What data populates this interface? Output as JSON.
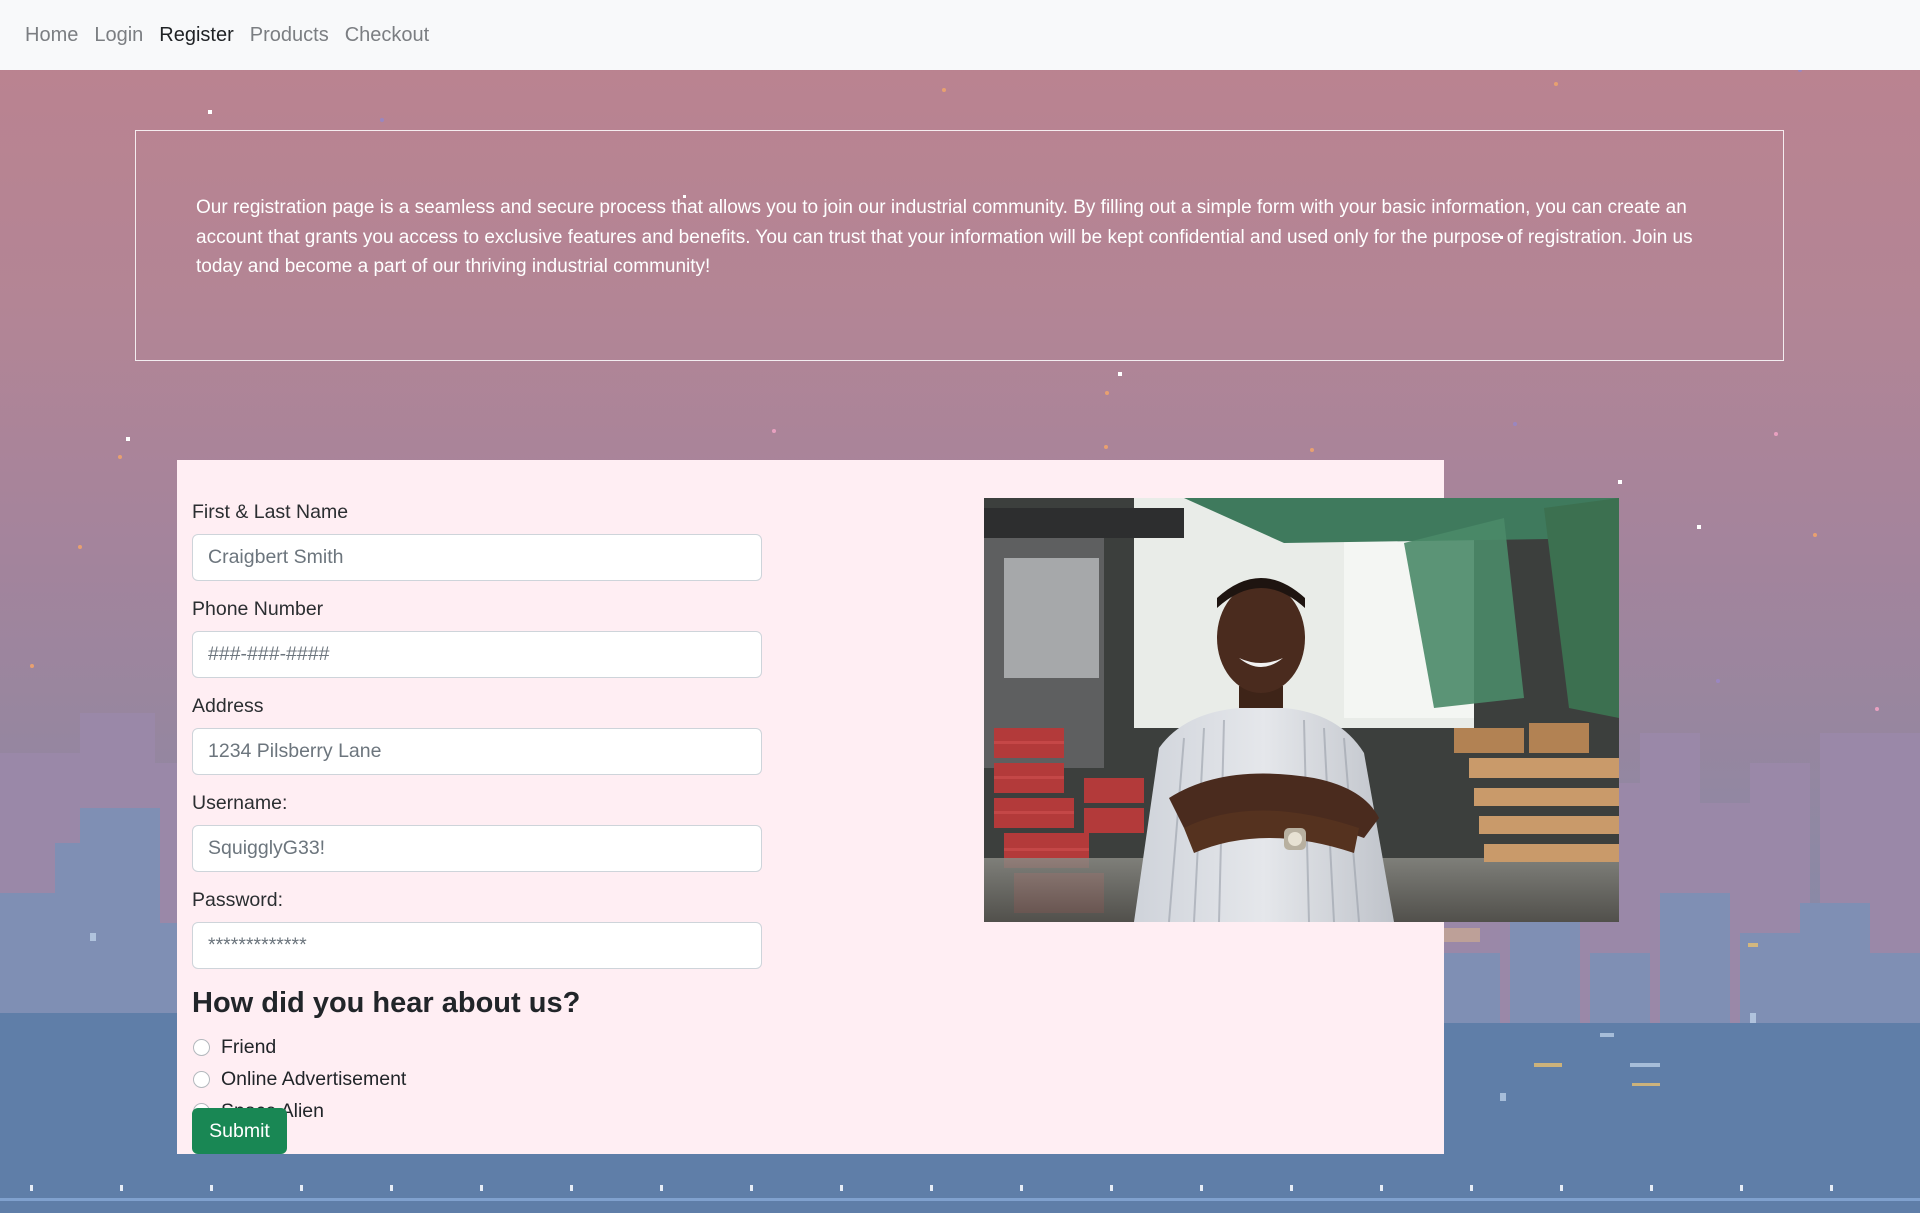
{
  "nav": {
    "items": [
      {
        "label": "Home",
        "active": false
      },
      {
        "label": "Login",
        "active": false
      },
      {
        "label": "Register",
        "active": true
      },
      {
        "label": "Products",
        "active": false
      },
      {
        "label": "Checkout",
        "active": false
      }
    ]
  },
  "intro": {
    "text": "Our registration page is a seamless and secure process that allows you to join our industrial community. By filling out a simple form with your basic information, you can create an account that grants you access to exclusive features and benefits. You can trust that your information will be kept confidential and used only for the purpose of registration. Join us today and become a part of our thriving industrial community!"
  },
  "form": {
    "fields": [
      {
        "label": "First & Last Name",
        "placeholder": "Craigbert Smith",
        "value": ""
      },
      {
        "label": "Phone Number",
        "placeholder": "###-###-####",
        "value": ""
      },
      {
        "label": "Address",
        "placeholder": "1234 Pilsberry Lane",
        "value": ""
      },
      {
        "label": "Username:",
        "placeholder": "SquigglyG33!",
        "value": ""
      },
      {
        "label": "Password:",
        "placeholder": "*************",
        "value": ""
      }
    ],
    "question": "How did you hear about us?",
    "options": [
      "Friend",
      "Online Advertisement",
      "Space Alien"
    ],
    "submit_label": "Submit"
  },
  "colors": {
    "navbar_bg": "#f8f9fa",
    "card_bg": "#ffeef3",
    "submit_bg": "#198754",
    "sky_top": "#bc828f",
    "sky_bottom": "#7c8aac"
  }
}
